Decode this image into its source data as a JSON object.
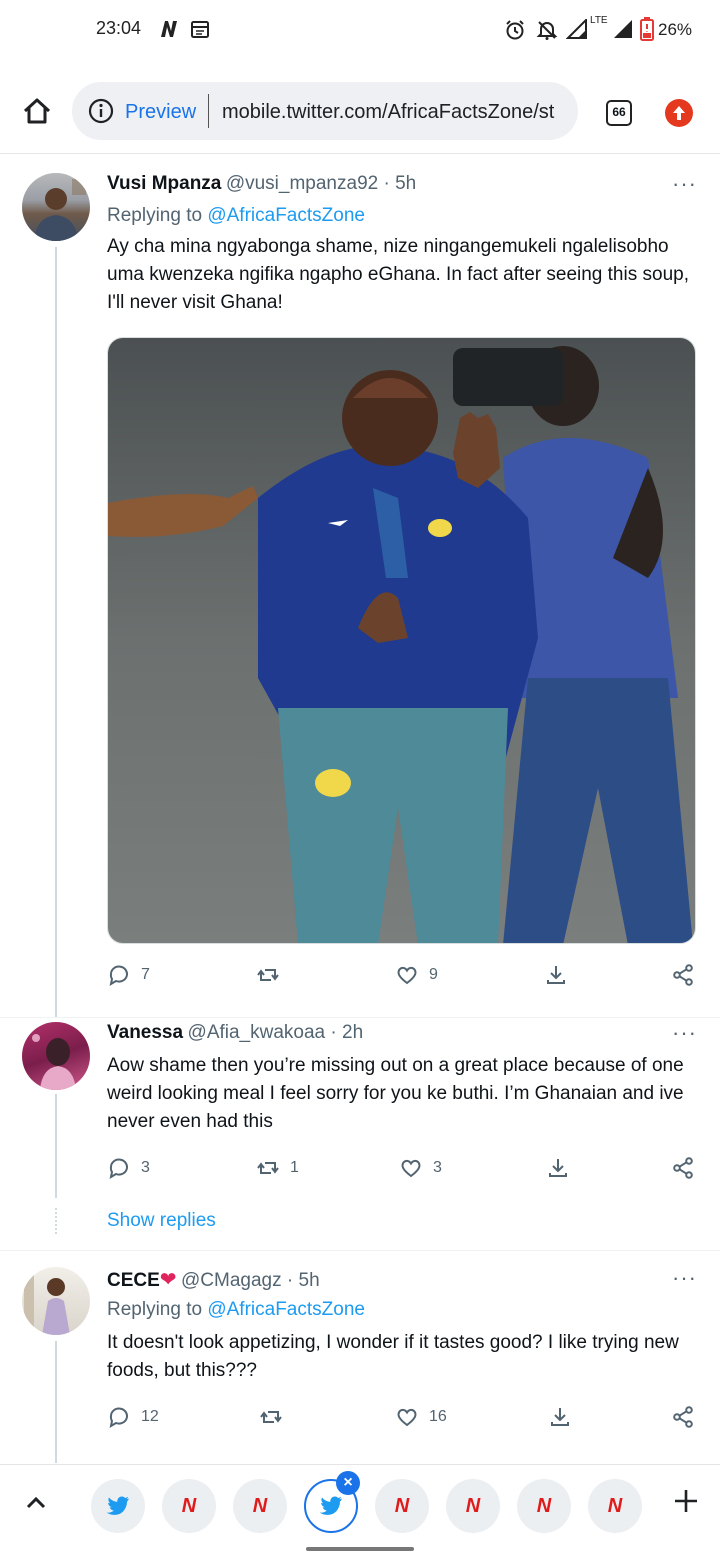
{
  "status_bar": {
    "time": "23:04",
    "battery_percent": "26%",
    "icons": [
      "n-app-icon",
      "calendar-icon",
      "alarm-icon",
      "mute-icon",
      "signal-icon",
      "lte-icon",
      "signal-icon",
      "battery-icon"
    ],
    "lte_label": "LTE"
  },
  "browser": {
    "preview_label": "Preview",
    "url": "mobile.twitter.com/AfricaFactsZone/st",
    "tab_count": "66"
  },
  "tweets": [
    {
      "name": "Vusi Mpanza",
      "handle": "@vusi_mpanza92",
      "time": "5h",
      "meta": "@vusi_mpanza92 · 5h",
      "replying_prefix": "Replying to ",
      "replying_to": "@AfricaFactsZone",
      "text": "Ay cha mina ngyabonga shame, nize ningangemukeli ngalelisobho uma kwenzeka ngifika ngapho eGhana. In fact after seeing this soup, I'll never visit Ghana!",
      "has_photo": true,
      "replies": "7",
      "retweets": "",
      "likes": "9"
    },
    {
      "name": "Vanessa",
      "handle": "@Afia_kwakoaa",
      "time": "2h",
      "meta": "@Afia_kwakoaa · 2h",
      "text": "Aow shame then you’re missing out on a great place because of one weird looking meal I feel sorry for you ke buthi. I’m Ghanaian and ive never even had this",
      "replies": "3",
      "retweets": "1",
      "likes": "3",
      "show_replies": "Show replies"
    },
    {
      "name": "CECE",
      "name_emoji": "❤",
      "handle": "@CMagagz",
      "time": "5h",
      "meta": "@CMagagz · 5h",
      "replying_prefix": "Replying to ",
      "replying_to": "@AfricaFactsZone",
      "text": "It doesn't look appetizing, I wonder if it tastes good? I like trying new foods, but this???",
      "replies": "12",
      "retweets": "",
      "likes": "16"
    }
  ],
  "more_label": "···",
  "tab_strip": {
    "tabs": [
      "twitter",
      "n",
      "n",
      "twitter-active",
      "n",
      "n",
      "n",
      "n"
    ],
    "n_label": "N",
    "close_label": "×",
    "new_tab_label": "+",
    "collapse_label": "^"
  },
  "colors": {
    "link_blue": "#1d9bf0",
    "chrome_blue": "#1a73e8",
    "n_red": "#e01b1b",
    "muted": "#536471"
  }
}
